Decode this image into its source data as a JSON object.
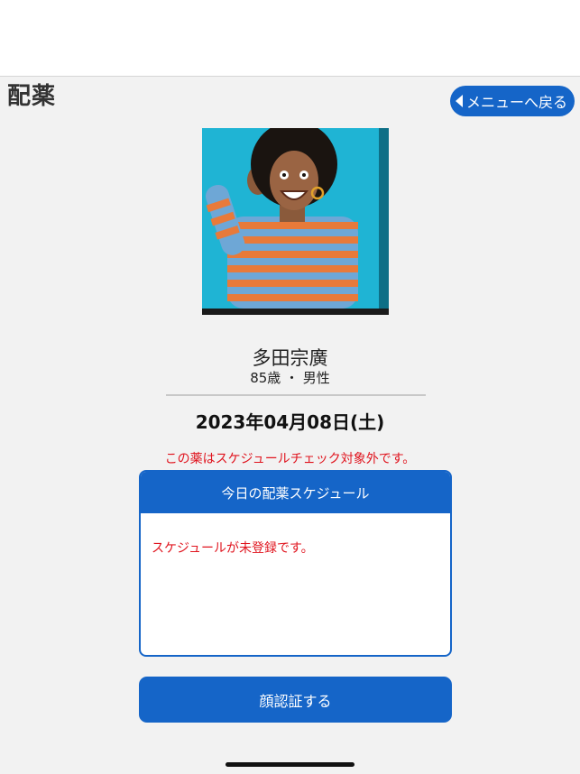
{
  "header": {
    "title": "配薬",
    "back_label": "メニューへ戻る"
  },
  "patient": {
    "name": "多田宗廣",
    "age_gender": "85歳 ・ 男性",
    "photo_icon": "patient-photo"
  },
  "date": "2023年04月08日(土)",
  "notice": "この薬はスケジュールチェック対象外です。",
  "schedule": {
    "header": "今日の配薬スケジュール",
    "message": "スケジュールが未登録です。"
  },
  "actions": {
    "face_auth_label": "顔認証する"
  },
  "colors": {
    "accent": "#1565c8",
    "warning": "#e0141e",
    "background": "#f2f2f2"
  }
}
